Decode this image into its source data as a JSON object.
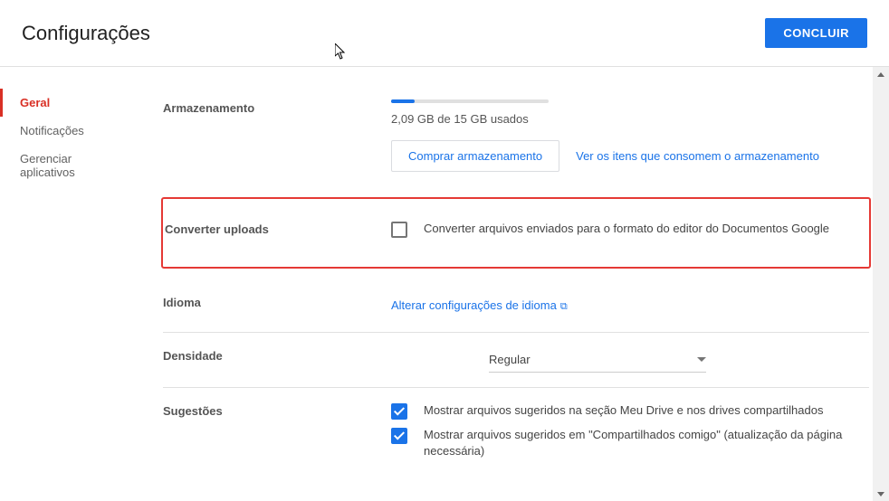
{
  "header": {
    "title": "Configurações",
    "done_label": "CONCLUIR"
  },
  "sidebar": {
    "items": [
      {
        "label": "Geral"
      },
      {
        "label": "Notificações"
      },
      {
        "label": "Gerenciar aplicativos"
      }
    ]
  },
  "storage": {
    "label": "Armazenamento",
    "usage_text": "2,09 GB de 15 GB usados",
    "buy_label": "Comprar armazenamento",
    "view_link": "Ver os itens que consomem o armazenamento"
  },
  "convert": {
    "label": "Converter uploads",
    "checkbox_label": "Converter arquivos enviados para o formato do editor do Documentos Google"
  },
  "language": {
    "label": "Idioma",
    "link": "Alterar configurações de idioma"
  },
  "density": {
    "label": "Densidade",
    "value": "Regular"
  },
  "suggestions": {
    "label": "Sugestões",
    "opt1": "Mostrar arquivos sugeridos na seção Meu Drive e nos drives compartilhados",
    "opt2": "Mostrar arquivos sugeridos em \"Compartilhados comigo\" (atualização da página necessária)"
  }
}
